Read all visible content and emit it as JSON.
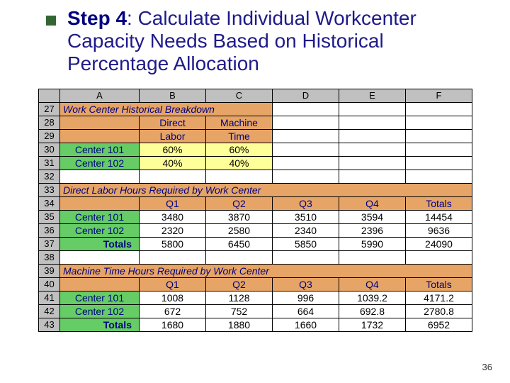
{
  "title": {
    "step_label": "Step 4",
    "rest": ": Calculate Individual Workcenter Capacity Needs Based on Historical Percentage Allocation"
  },
  "page_number": "36",
  "spreadsheet": {
    "col_headers": [
      "A",
      "B",
      "C",
      "D",
      "E",
      "F"
    ],
    "row_numbers": [
      "27",
      "28",
      "29",
      "30",
      "31",
      "32",
      "33",
      "34",
      "35",
      "36",
      "37",
      "38",
      "39",
      "40",
      "41",
      "42",
      "43"
    ],
    "section1": {
      "title": "Work Center Historical Breakdown",
      "sub_b": "Direct",
      "sub_c": "Machine",
      "sub_b2": "Labor",
      "sub_c2": "Time",
      "rows": [
        {
          "label": "Center 101",
          "b": "60%",
          "c": "60%"
        },
        {
          "label": "Center 102",
          "b": "40%",
          "c": "40%"
        }
      ]
    },
    "section2": {
      "title": "Direct Labor Hours Required by Work Center",
      "headers": [
        "Q1",
        "Q2",
        "Q3",
        "Q4",
        "Totals"
      ],
      "rows": [
        {
          "label": "Center 101",
          "values": [
            "3480",
            "3870",
            "3510",
            "3594",
            "14454"
          ]
        },
        {
          "label": "Center 102",
          "values": [
            "2320",
            "2580",
            "2340",
            "2396",
            "9636"
          ]
        },
        {
          "label": "Totals",
          "values": [
            "5800",
            "6450",
            "5850",
            "5990",
            "24090"
          ]
        }
      ]
    },
    "section3": {
      "title": "Machine Time Hours Required by Work Center",
      "headers": [
        "Q1",
        "Q2",
        "Q3",
        "Q4",
        "Totals"
      ],
      "rows": [
        {
          "label": "Center 101",
          "values": [
            "1008",
            "1128",
            "996",
            "1039.2",
            "4171.2"
          ]
        },
        {
          "label": "Center 102",
          "values": [
            "672",
            "752",
            "664",
            "692.8",
            "2780.8"
          ]
        },
        {
          "label": "Totals",
          "values": [
            "1680",
            "1880",
            "1660",
            "1732",
            "6952"
          ]
        }
      ]
    }
  }
}
